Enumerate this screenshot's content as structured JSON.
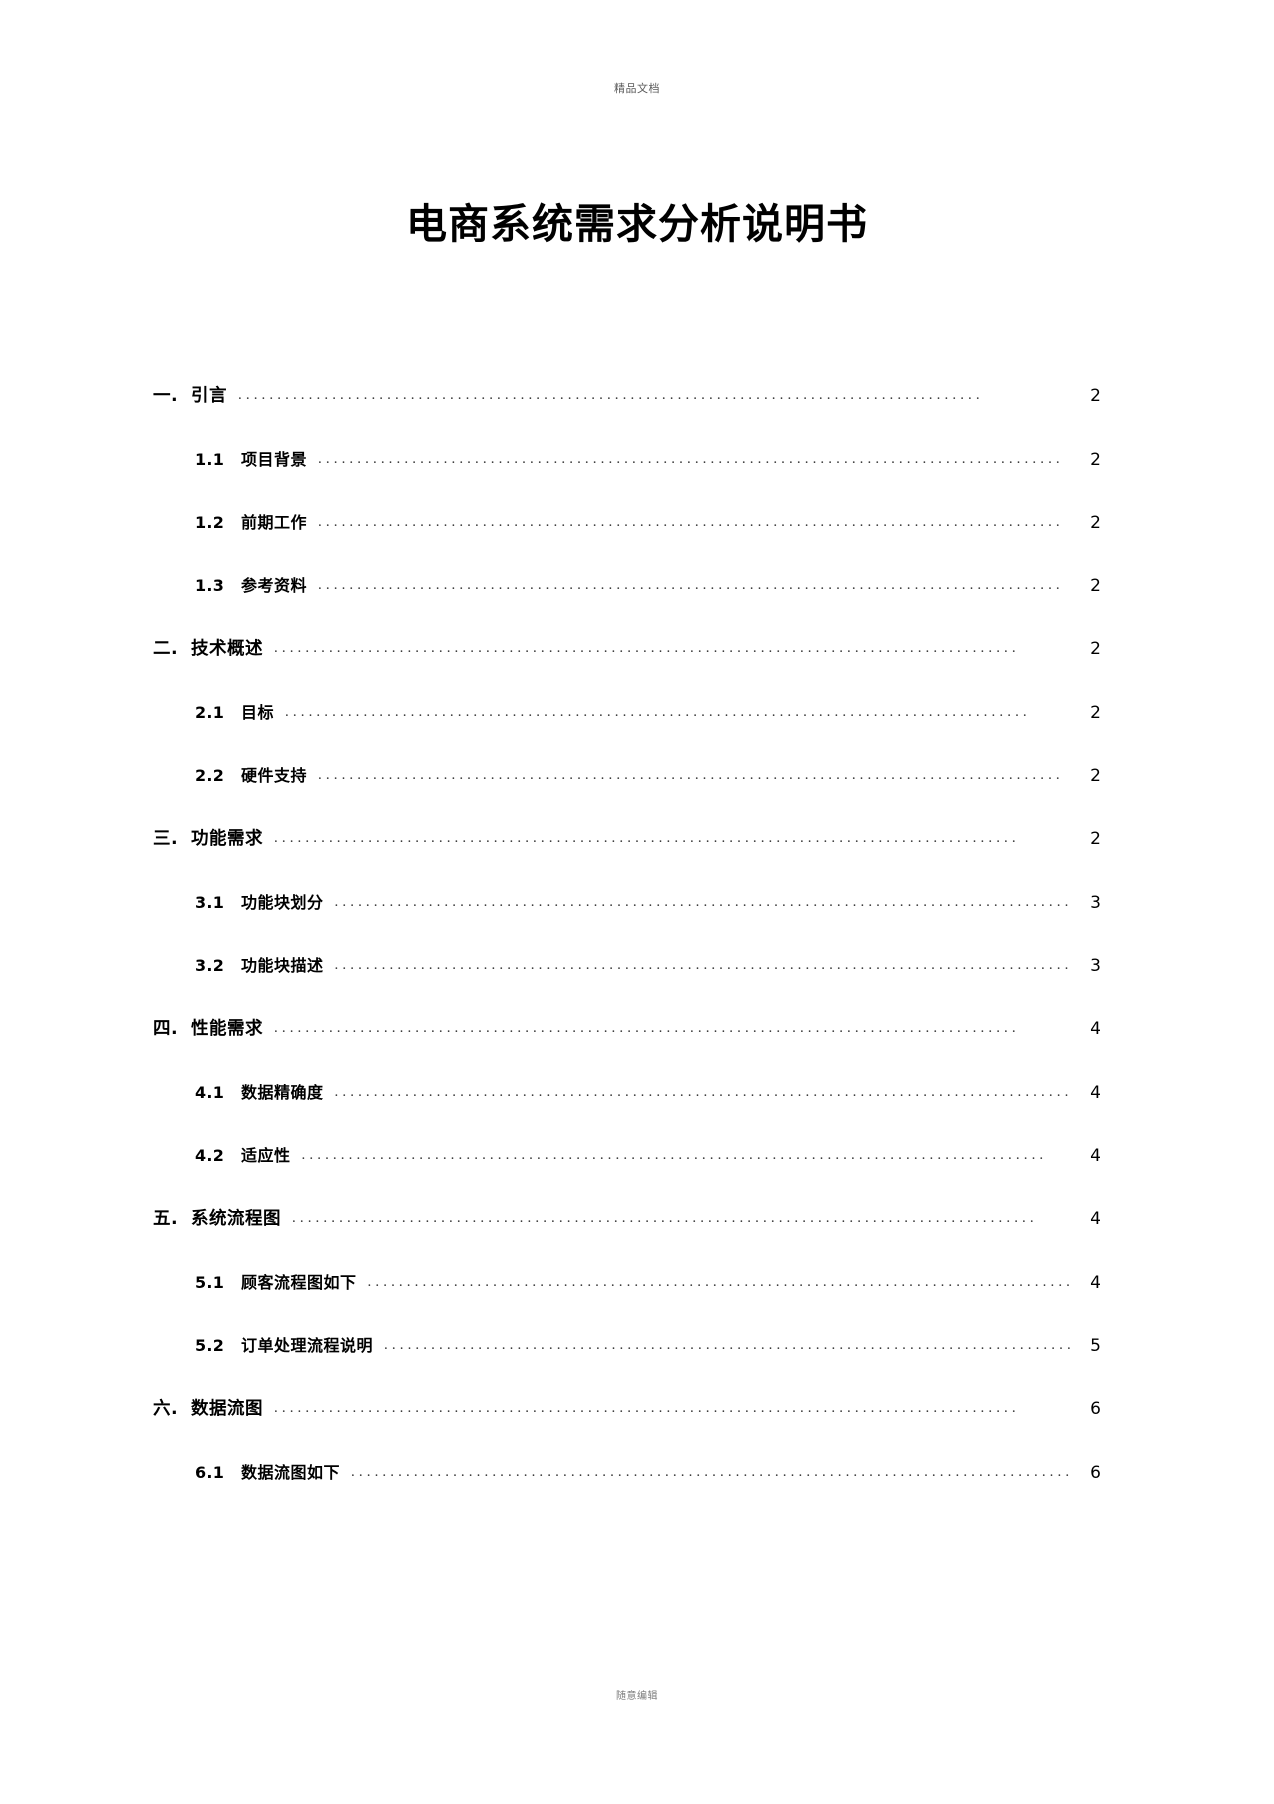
{
  "header": {
    "watermark": "精品文档"
  },
  "title": "电商系统需求分析说明书",
  "toc": {
    "entries": [
      {
        "level": 1,
        "num": "一.",
        "label": "引言",
        "page": "2"
      },
      {
        "level": 2,
        "num": "1.1",
        "label": "项目背景",
        "page": "2"
      },
      {
        "level": 2,
        "num": "1.2",
        "label": "前期工作",
        "page": "2"
      },
      {
        "level": 2,
        "num": "1.3",
        "label": "参考资料",
        "page": "2"
      },
      {
        "level": 1,
        "num": "二.",
        "label": "技术概述",
        "page": "2"
      },
      {
        "level": 2,
        "num": "2.1",
        "label": "目标",
        "page": "2"
      },
      {
        "level": 2,
        "num": "2.2",
        "label": "硬件支持",
        "page": "2"
      },
      {
        "level": 1,
        "num": "三.",
        "label": "功能需求",
        "page": "2"
      },
      {
        "level": 2,
        "num": "3.1",
        "label": "功能块划分",
        "page": "3"
      },
      {
        "level": 2,
        "num": "3.2",
        "label": "功能块描述",
        "page": "3"
      },
      {
        "level": 1,
        "num": "四.",
        "label": "性能需求",
        "page": "4"
      },
      {
        "level": 2,
        "num": "4.1",
        "label": "数据精确度",
        "page": "4"
      },
      {
        "level": 2,
        "num": "4.2",
        "label": "适应性",
        "page": "4"
      },
      {
        "level": 1,
        "num": "五.",
        "label": "系统流程图",
        "page": "4"
      },
      {
        "level": 2,
        "num": "5.1",
        "label": "顾客流程图如下",
        "page": "4"
      },
      {
        "level": 2,
        "num": "5.2",
        "label": "订单处理流程说明",
        "page": "5"
      },
      {
        "level": 1,
        "num": "六.",
        "label": "数据流图",
        "page": "6"
      },
      {
        "level": 2,
        "num": "6.1",
        "label": "数据流图如下",
        "page": "6"
      }
    ],
    "leader": "..............................................................................................."
  },
  "footer": {
    "watermark": "随意编辑"
  }
}
